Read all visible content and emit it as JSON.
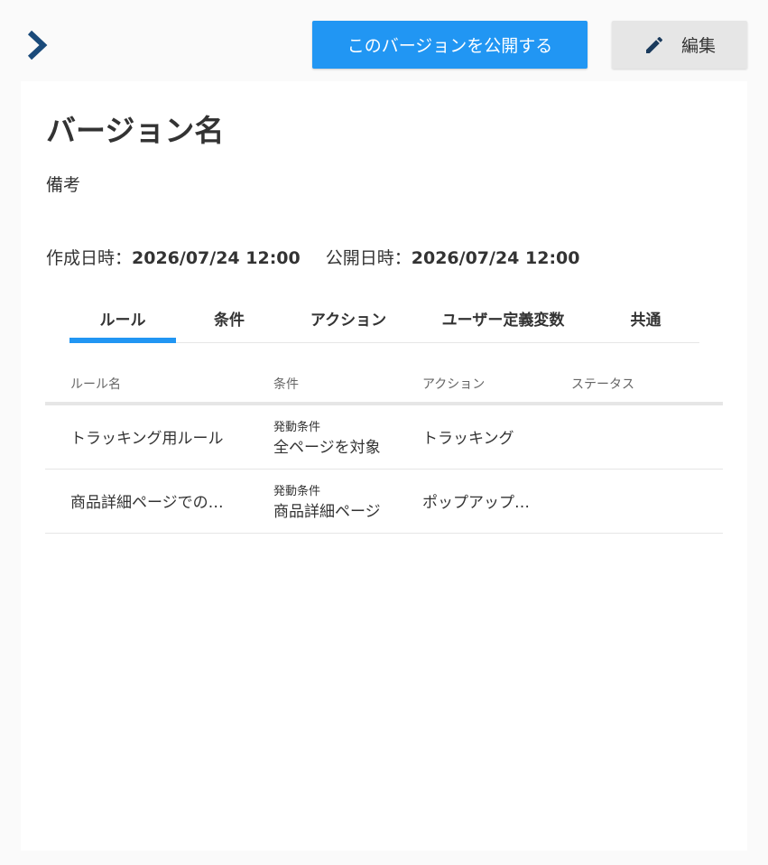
{
  "header": {
    "chevron_icon": "chevron-right-icon",
    "publish_label": "このバージョンを公開する",
    "edit_label": "編集",
    "edit_icon": "pencil-icon"
  },
  "version": {
    "name": "バージョン名",
    "note": "備考",
    "created_label": "作成日時：",
    "created_value": "2026/07/24 12:00",
    "published_label": "公開日時：",
    "published_value": "2026/07/24 12:00"
  },
  "tabs": [
    {
      "label": "ルール",
      "active": true
    },
    {
      "label": "条件",
      "active": false
    },
    {
      "label": "アクション",
      "active": false
    },
    {
      "label": "ユーザー定義変数",
      "active": false
    },
    {
      "label": "共通",
      "active": false
    }
  ],
  "table": {
    "columns": [
      "ルール名",
      "条件",
      "アクション",
      "ステータス"
    ],
    "rows": [
      {
        "name": "トラッキング用ルール",
        "cond_label": "発動条件",
        "cond_value": "全ページを対象",
        "action": "トラッキング",
        "status": ""
      },
      {
        "name": "商品詳細ページでの…",
        "cond_label": "発動条件",
        "cond_value": "商品詳細ページ",
        "action": "ポップアップ…",
        "status": ""
      }
    ]
  },
  "colors": {
    "accent": "#2196f3",
    "chevron": "#1a4a7a",
    "edit_button_bg": "#e6e6e6",
    "page_bg": "#fafafa"
  }
}
